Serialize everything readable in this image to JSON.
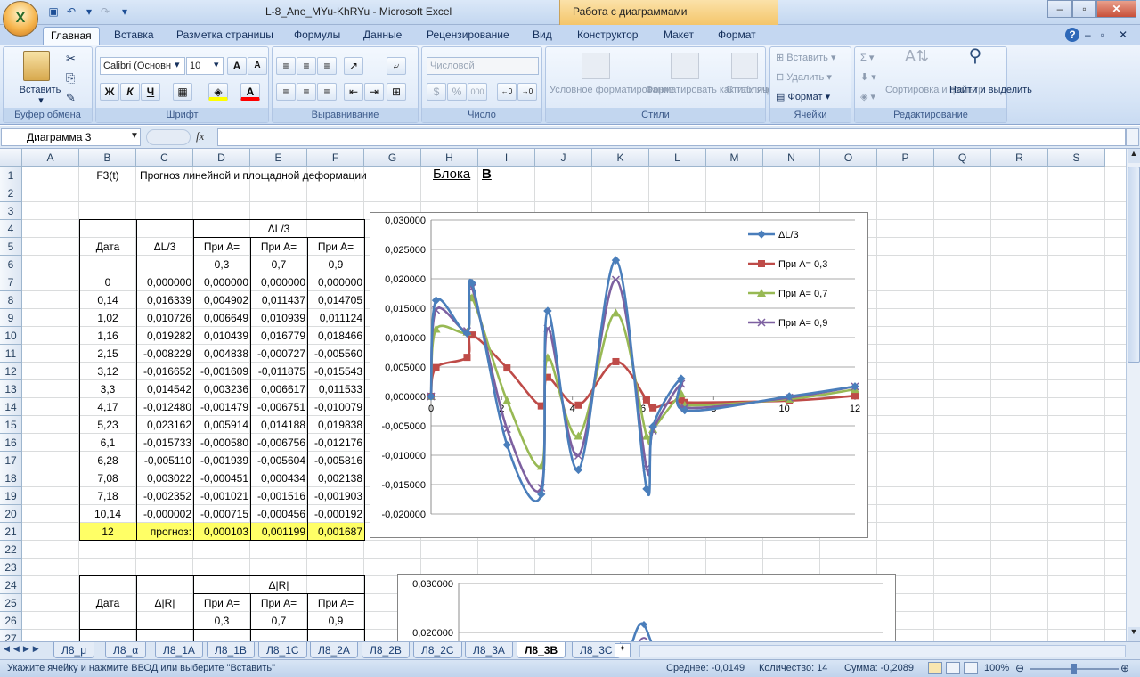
{
  "window": {
    "title": "L-8_Ane_MYu-KhRYu - Microsoft Excel",
    "context_title": "Работа с диаграммами"
  },
  "tabs": [
    "Главная",
    "Вставка",
    "Разметка страницы",
    "Формулы",
    "Данные",
    "Рецензирование",
    "Вид",
    "Конструктор",
    "Макет",
    "Формат"
  ],
  "ribbon": {
    "clipboard": {
      "paste": "Вставить",
      "label": "Буфер обмена"
    },
    "font": {
      "name": "Calibri (Основн",
      "size": "10",
      "label": "Шрифт",
      "bold": "Ж",
      "italic": "К",
      "underline": "Ч"
    },
    "alignment": {
      "label": "Выравнивание"
    },
    "number": {
      "format": "Числовой",
      "label": "Число",
      "percent": "%",
      "thousands": "000"
    },
    "styles": {
      "cond": "Условное форматирование",
      "table": "Форматировать как таблицу",
      "cell": "Стили ячеек",
      "label": "Стили"
    },
    "cells": {
      "insert": "Вставить",
      "delete": "Удалить",
      "format": "Формат",
      "label": "Ячейки"
    },
    "editing": {
      "sort": "Сортировка и фильтр",
      "find": "Найти и выделить",
      "label": "Редактирование"
    }
  },
  "formula_bar": {
    "name_box": "Диаграмма 3",
    "fx": "fx",
    "value": ""
  },
  "columns": [
    "A",
    "B",
    "C",
    "D",
    "E",
    "F",
    "G",
    "H",
    "I",
    "J",
    "K",
    "L",
    "M",
    "N",
    "O",
    "P",
    "Q",
    "R",
    "S"
  ],
  "rows": [
    "1",
    "2",
    "3",
    "4",
    "5",
    "6",
    "7",
    "8",
    "9",
    "10",
    "11",
    "12",
    "13",
    "14",
    "15",
    "16",
    "17",
    "18",
    "19",
    "20",
    "21",
    "22",
    "23",
    "24",
    "25",
    "26",
    "27"
  ],
  "sheet_text": {
    "b1": "F3(t)",
    "c1": "Прогноз линейной и площадной  деформации",
    "h1": "Блока",
    "i1": "В",
    "t1_group": "ΔL/3",
    "t1_date": "Дата",
    "t1_dl": "ΔL/3",
    "t2_group": "Δ|R|",
    "t2_date": "Дата",
    "t2_dr": "Δ|R|",
    "pri": "При А=",
    "a03": "0,3",
    "a07": "0,7",
    "a09": "0,9",
    "forecast_label": "прогноз:"
  },
  "table": [
    [
      "0",
      "0,000000",
      "0,000000",
      "0,000000",
      "0,000000"
    ],
    [
      "0,14",
      "0,016339",
      "0,004902",
      "0,011437",
      "0,014705"
    ],
    [
      "1,02",
      "0,010726",
      "0,006649",
      "0,010939",
      "0,011124"
    ],
    [
      "1,16",
      "0,019282",
      "0,010439",
      "0,016779",
      "0,018466"
    ],
    [
      "2,15",
      "-0,008229",
      "0,004838",
      "-0,000727",
      "-0,005560"
    ],
    [
      "3,12",
      "-0,016652",
      "-0,001609",
      "-0,011875",
      "-0,015543"
    ],
    [
      "3,3",
      "0,014542",
      "0,003236",
      "0,006617",
      "0,011533"
    ],
    [
      "4,17",
      "-0,012480",
      "-0,001479",
      "-0,006751",
      "-0,010079"
    ],
    [
      "5,23",
      "0,023162",
      "0,005914",
      "0,014188",
      "0,019838"
    ],
    [
      "6,1",
      "-0,015733",
      "-0,000580",
      "-0,006756",
      "-0,012176"
    ],
    [
      "6,28",
      "-0,005110",
      "-0,001939",
      "-0,005604",
      "-0,005816"
    ],
    [
      "7,08",
      "0,003022",
      "-0,000451",
      "0,000434",
      "0,002138"
    ],
    [
      "7,18",
      "-0,002352",
      "-0,001021",
      "-0,001516",
      "-0,001903"
    ],
    [
      "10,14",
      "-0,000002",
      "-0,000715",
      "-0,000456",
      "-0,000192"
    ]
  ],
  "forecast": {
    "date": "12",
    "a03": "0,000103",
    "a07": "0,001199",
    "a09": "0,001687"
  },
  "chart_data": [
    {
      "type": "scatter",
      "smooth": true,
      "x": [
        0,
        0.14,
        1.02,
        1.16,
        2.15,
        3.12,
        3.3,
        4.17,
        5.23,
        6.1,
        6.28,
        7.08,
        7.18,
        10.14,
        12
      ],
      "series": [
        {
          "name": "ΔL/3",
          "color": "#4a7ebb",
          "marker": "diamond",
          "values": [
            0,
            0.016339,
            0.010726,
            0.019282,
            -0.008229,
            -0.016652,
            0.014542,
            -0.01248,
            0.023162,
            -0.015733,
            -0.00511,
            0.003022,
            -0.002352,
            -2e-06,
            0.001687
          ]
        },
        {
          "name": "При А= 0,3",
          "color": "#be4b48",
          "marker": "square",
          "values": [
            0,
            0.004902,
            0.006649,
            0.010439,
            0.004838,
            -0.001609,
            0.003236,
            -0.001479,
            0.005914,
            -0.00058,
            -0.001939,
            -0.000451,
            -0.001021,
            -0.000715,
            0.000103
          ]
        },
        {
          "name": "При А= 0,7",
          "color": "#98b954",
          "marker": "triangle",
          "values": [
            0,
            0.011437,
            0.010939,
            0.016779,
            -0.000727,
            -0.011875,
            0.006617,
            -0.006751,
            0.014188,
            -0.006756,
            -0.005604,
            0.000434,
            -0.001516,
            -0.000456,
            0.001199
          ]
        },
        {
          "name": "При А= 0,9",
          "color": "#7d60a0",
          "marker": "x",
          "values": [
            0,
            0.014705,
            0.011124,
            0.018466,
            -0.00556,
            -0.015543,
            0.011533,
            -0.010079,
            0.019838,
            -0.012176,
            -0.005816,
            0.002138,
            -0.001903,
            -0.000192,
            0.001687
          ]
        }
      ],
      "xlim": [
        0,
        12
      ],
      "xticks": [
        "0",
        "2",
        "4",
        "6",
        "8",
        "10",
        "12"
      ],
      "ylim": [
        -0.02,
        0.03
      ],
      "yticks": [
        "0,030000",
        "0,025000",
        "0,020000",
        "0,015000",
        "0,010000",
        "0,005000",
        "0,000000",
        "-0,005000",
        "-0,010000",
        "-0,015000",
        "-0,020000"
      ],
      "grid": true,
      "legend": "right"
    },
    {
      "type": "scatter",
      "partial": true,
      "yticks": [
        "0,030000",
        "0,020000"
      ],
      "ylim": [
        -0.02,
        0.03
      ],
      "grid": true
    }
  ],
  "sheets": [
    "Л8_μ",
    "Л8_α",
    "Л8_1А",
    "Л8_1В",
    "Л8_1С",
    "Л8_2А",
    "Л8_2В",
    "Л8_2С",
    "Л8_3А",
    "Л8_3В",
    "Л8_3С"
  ],
  "active_sheet": "Л8_3В",
  "status": {
    "message": "Укажите ячейку и нажмите ВВОД или выберите \"Вставить\"",
    "average": "Среднее: -0,0149",
    "count": "Количество: 14",
    "sum": "Сумма: -0,2089",
    "zoom": "100%"
  }
}
